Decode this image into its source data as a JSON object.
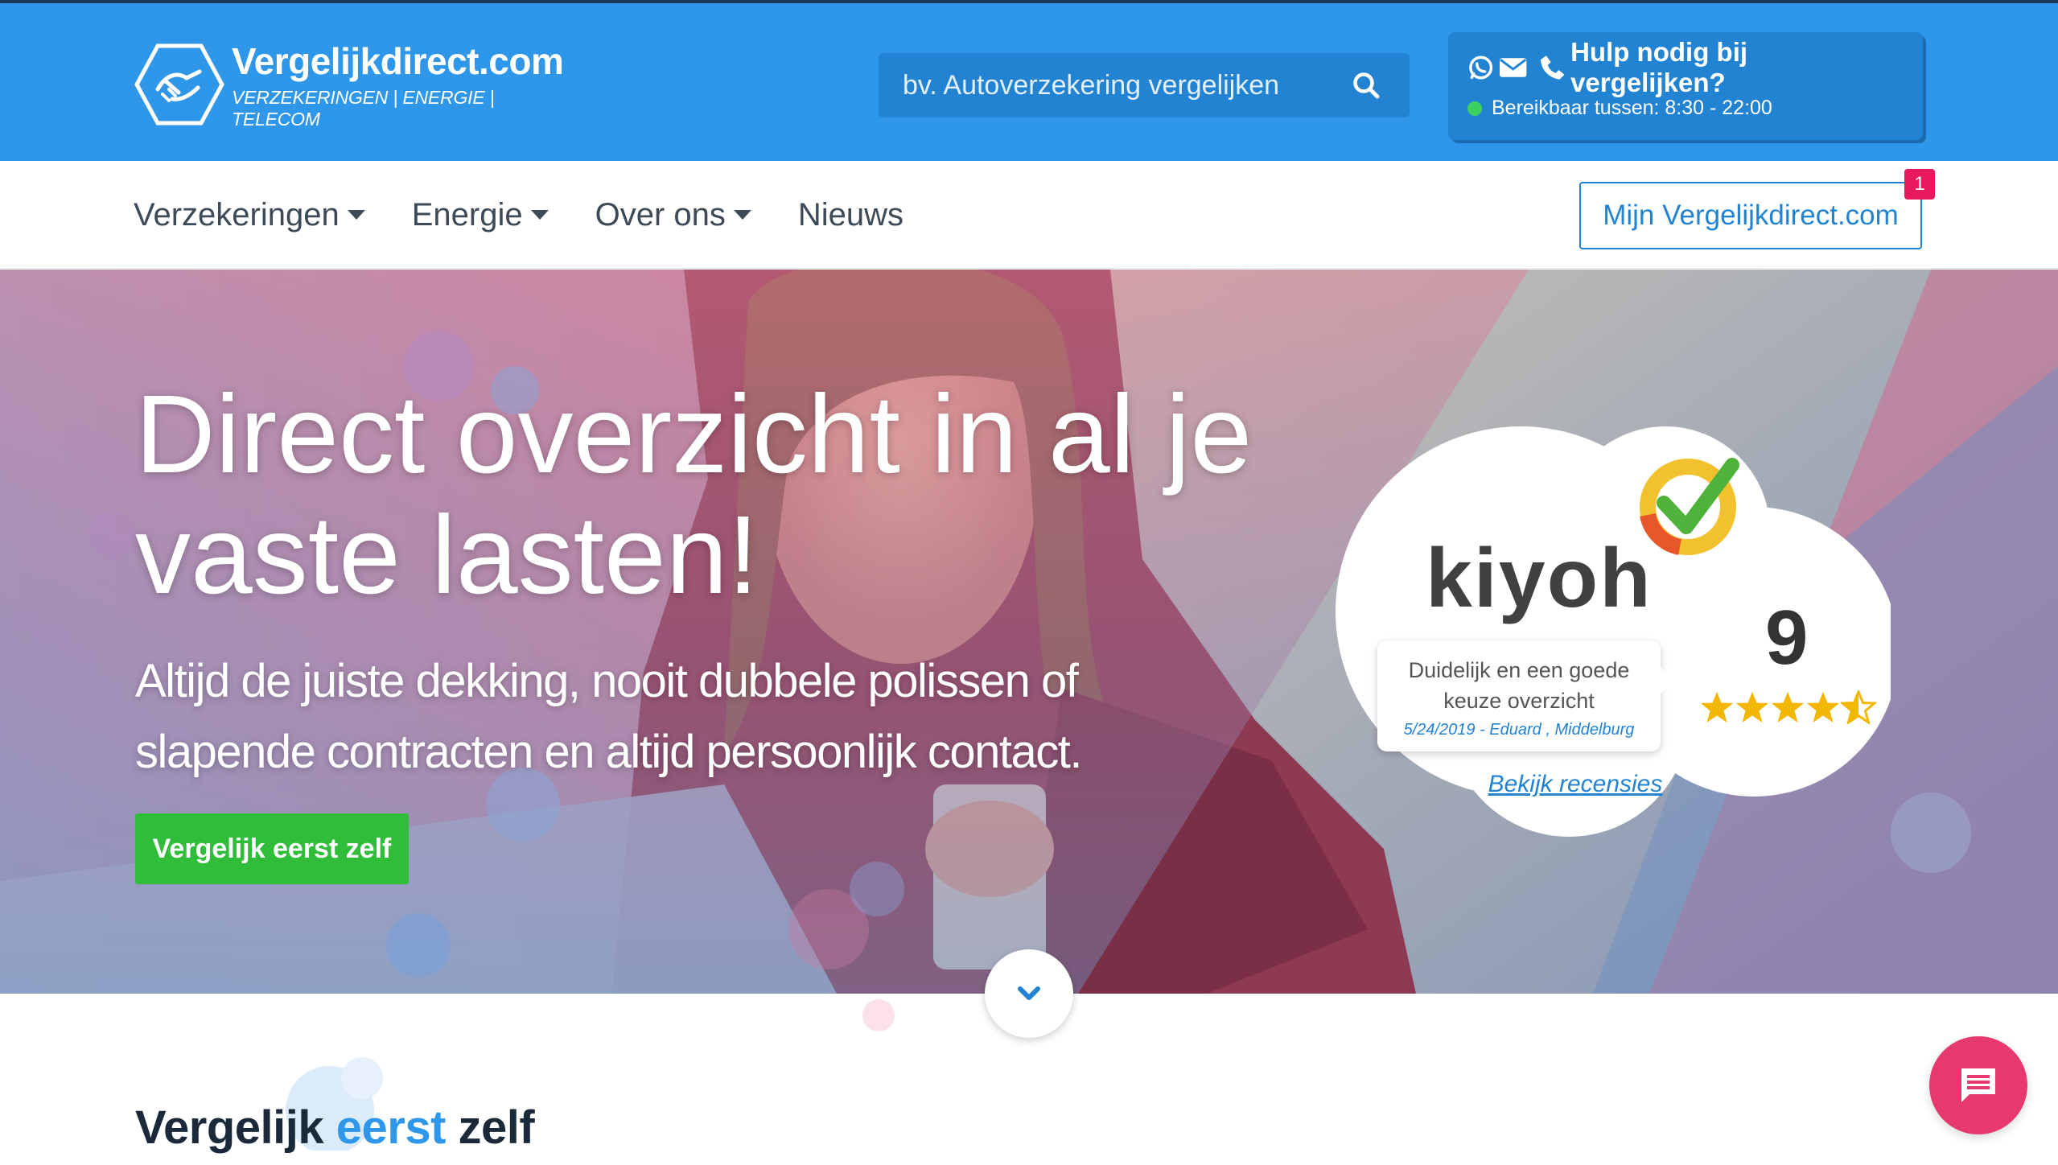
{
  "header": {
    "logo_name": "Vergelijkdirect.com",
    "logo_tagline": "VERZEKERINGEN | ENERGIE | TELECOM",
    "search_placeholder": "bv. Autoverzekering vergelijken",
    "help_title": "Hulp nodig bij vergelijken?",
    "help_hours": "Bereikbaar tussen: 8:30 - 22:00",
    "brand_color": "#2f97e9"
  },
  "nav": {
    "items": [
      {
        "label": "Verzekeringen",
        "dropdown": true
      },
      {
        "label": "Energie",
        "dropdown": true
      },
      {
        "label": "Over ons",
        "dropdown": true
      },
      {
        "label": "Nieuws",
        "dropdown": false
      }
    ],
    "account_label": "Mijn Vergelijkdirect.com",
    "notification_count": "1"
  },
  "hero": {
    "title": "Direct overzicht in al je vaste lasten!",
    "subtitle": "Altijd de juiste dekking, nooit dubbele polissen of slapende contracten en altijd persoonlijk contact.",
    "cta_label": "Vergelijk eerst zelf",
    "cta_color": "#2fbd3a"
  },
  "kiyoh": {
    "brand": "kiyoh",
    "score": "9",
    "stars": 4.5,
    "review_text": "Duidelijk en een goede keuze overzicht",
    "review_meta": "5/24/2019 - Eduard , Middelburg",
    "link_label": "Bekijk recensies"
  },
  "section": {
    "title_part1": "Vergelijk",
    "title_accent": "eerst",
    "title_part2": "zelf"
  },
  "icons": [
    "logo-badge-icon",
    "search-icon",
    "whatsapp-icon",
    "envelope-icon",
    "phone-icon",
    "chevron-down-icon",
    "chat-icon",
    "star-icon",
    "checkmark-icon"
  ]
}
